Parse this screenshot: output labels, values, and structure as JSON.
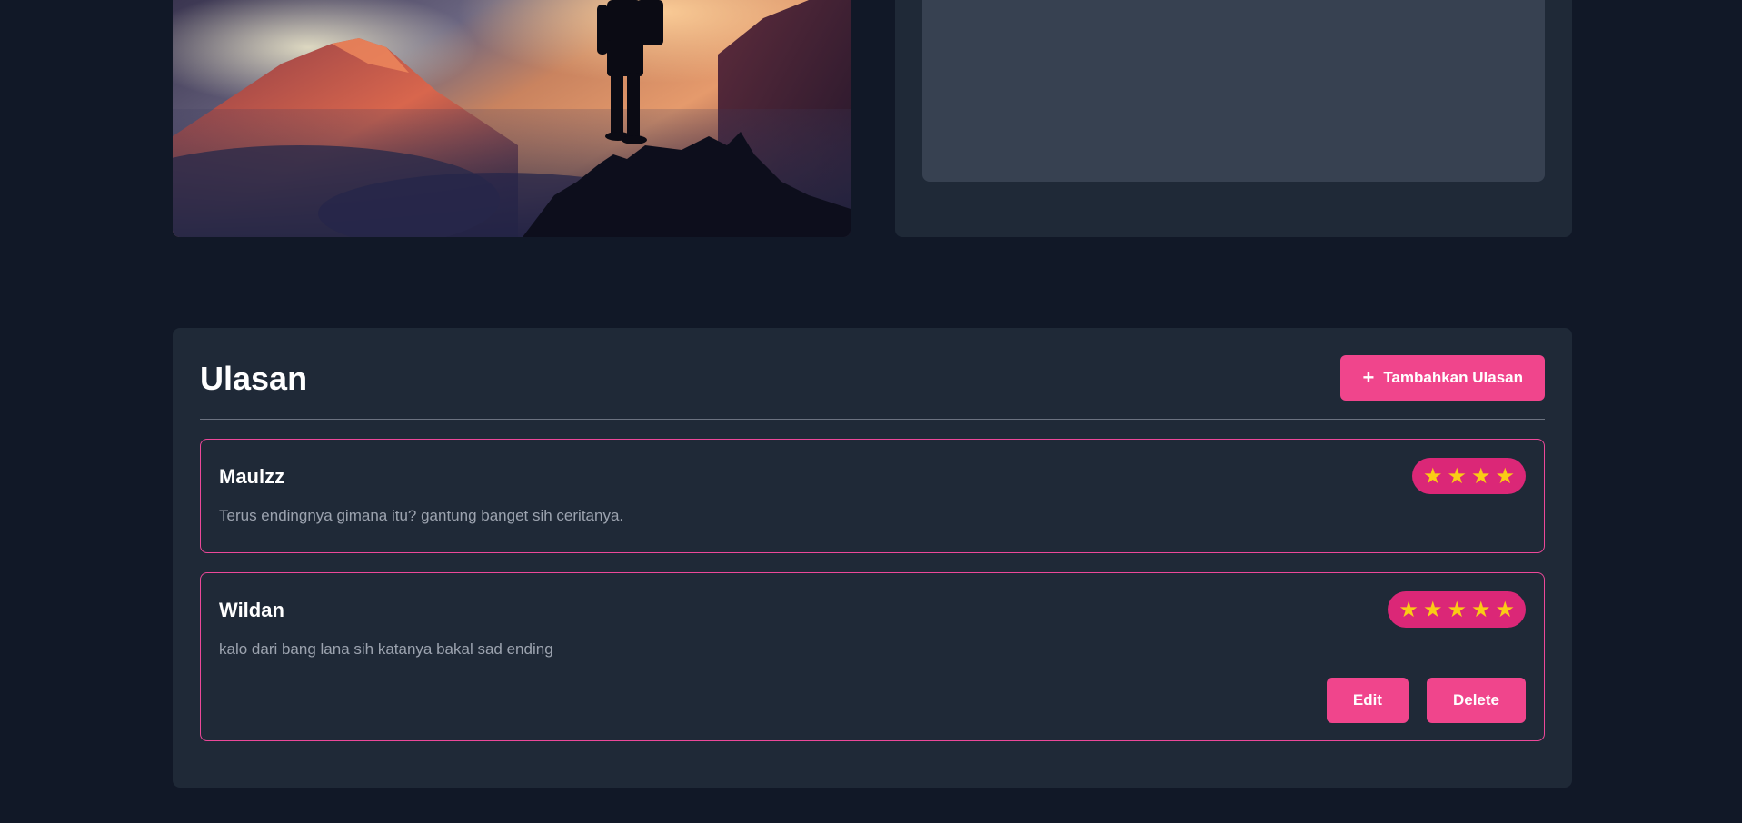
{
  "hero": {
    "image": "mountain-hiker-silhouette-image"
  },
  "side_panel": {
    "placeholder": "content-placeholder"
  },
  "reviews": {
    "title": "Ulasan",
    "add_button": {
      "icon": "plus-icon",
      "plus_glyph": "+",
      "label": "Tambahkan Ulasan"
    },
    "items": [
      {
        "name": "Maulzz",
        "comment": "Terus endingnya gimana itu? gantung banget sih ceritanya.",
        "rating": 4,
        "actions": []
      },
      {
        "name": "Wildan",
        "comment": "kalo dari bang lana sih katanya bakal sad ending",
        "rating": 5,
        "actions": [
          {
            "label": "Edit"
          },
          {
            "label": "Delete"
          }
        ]
      }
    ]
  },
  "colors": {
    "background": "#111827",
    "panel": "#1f2937",
    "placeholder": "#374151",
    "accent": "#f0458c",
    "rating_badge": "#db2777",
    "star": "#facc15",
    "card_border": "#ec4899",
    "comment_text": "#9ca3af"
  }
}
